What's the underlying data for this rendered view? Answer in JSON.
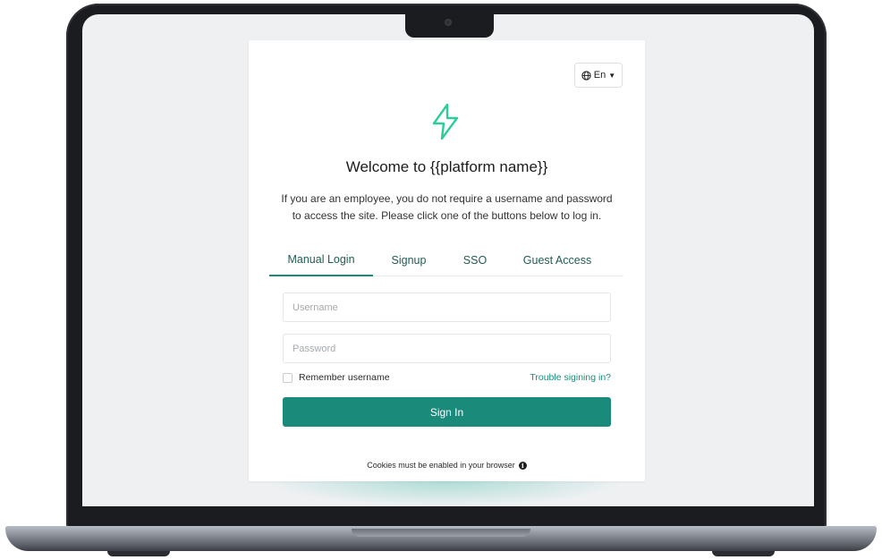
{
  "language": {
    "selected": "En",
    "icon": "globe-icon"
  },
  "logo": {
    "icon": "lightning-bolt-icon",
    "color": "#2ecc9a"
  },
  "welcome": {
    "title": "Welcome to {{platform name}}",
    "description": "If you are an employee, you do not require a username and password to access the site. Please click one of the buttons below to log in."
  },
  "tabs": [
    {
      "label": "Manual Login",
      "active": true
    },
    {
      "label": "Signup",
      "active": false
    },
    {
      "label": "SSO",
      "active": false
    },
    {
      "label": "Guest Access",
      "active": false
    }
  ],
  "form": {
    "username": {
      "placeholder": "Username",
      "value": ""
    },
    "password": {
      "placeholder": "Password",
      "value": ""
    },
    "remember_label": "Remember username",
    "remember_checked": false,
    "trouble_link": "Trouble sigining in?",
    "submit_label": "Sign In"
  },
  "footer": {
    "cookies_text": "Cookies must be enabled in your browser",
    "info_icon": "info-icon"
  },
  "colors": {
    "accent": "#1a8a7b",
    "tab_text": "#1f5c52",
    "logo": "#2ecc9a",
    "screen_bg": "#eef0f2"
  }
}
